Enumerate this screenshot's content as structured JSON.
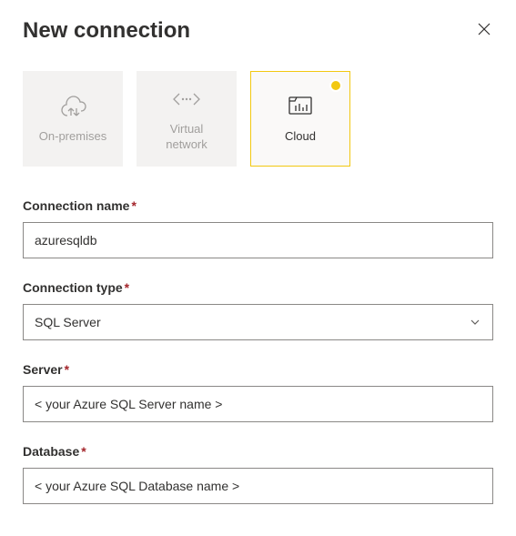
{
  "title": "New connection",
  "tiles": [
    {
      "label": "On-premises",
      "selected": false
    },
    {
      "label": "Virtual\nnetwork",
      "selected": false
    },
    {
      "label": "Cloud",
      "selected": true
    }
  ],
  "fields": {
    "connectionName": {
      "label": "Connection name",
      "required": true,
      "value": "azuresqldb"
    },
    "connectionType": {
      "label": "Connection type",
      "required": true,
      "value": "SQL Server"
    },
    "server": {
      "label": "Server",
      "required": true,
      "value": "< your Azure SQL Server name >"
    },
    "database": {
      "label": "Database",
      "required": true,
      "value": "< your Azure SQL Database name >"
    }
  }
}
